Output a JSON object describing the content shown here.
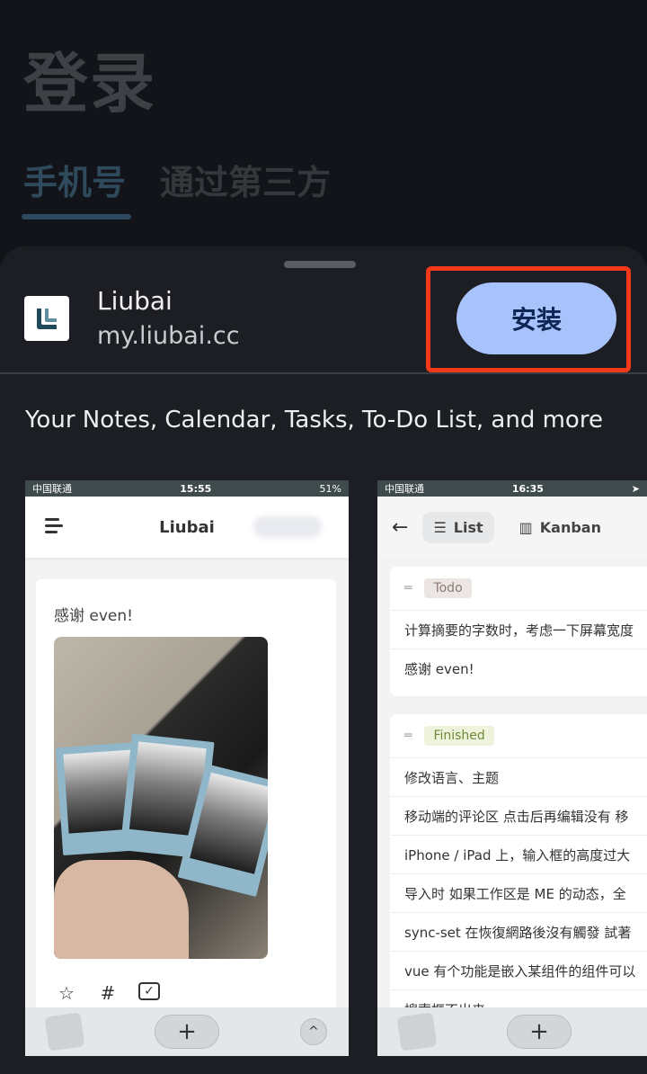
{
  "background": {
    "title": "登录",
    "tabs": [
      "手机号",
      "通过第三方"
    ]
  },
  "sheet": {
    "app_name": "Liubai",
    "app_url": "my.liubai.cc",
    "install_label": "安装",
    "description": "Your Notes, Calendar, Tasks, To-Do List, and more",
    "highlight_color": "#f23a1a",
    "install_color": "#a8c3fb"
  },
  "preview_left": {
    "status": {
      "carrier": "中国联通",
      "time": "15:55",
      "battery": "51%"
    },
    "title": "Liubai",
    "note_text": "感谢 even!",
    "actions": [
      "star-icon",
      "hashtag-icon",
      "checkbox-icon"
    ],
    "plus": "+",
    "up": "^"
  },
  "preview_right": {
    "status": {
      "carrier": "中国联通",
      "time": "16:35"
    },
    "tabs": {
      "list": "List",
      "kanban": "Kanban"
    },
    "group_todo": {
      "tag": "Todo",
      "items": [
        "计算摘要的字数时，考虑一下屏幕宽度",
        "感谢 even!"
      ]
    },
    "group_finished": {
      "tag": "Finished",
      "items": [
        "修改语言、主题",
        "移动端的评论区 点击后再编辑没有 移",
        "iPhone / iPad 上，输入框的高度过大",
        "导入时 如果工作区是 ME 的动态，全",
        "sync-set 在恢復網路後沒有觸發 試著",
        "vue 有个功能是嵌入某组件的组件可以",
        "搜索框不出来"
      ]
    },
    "plus": "+"
  }
}
